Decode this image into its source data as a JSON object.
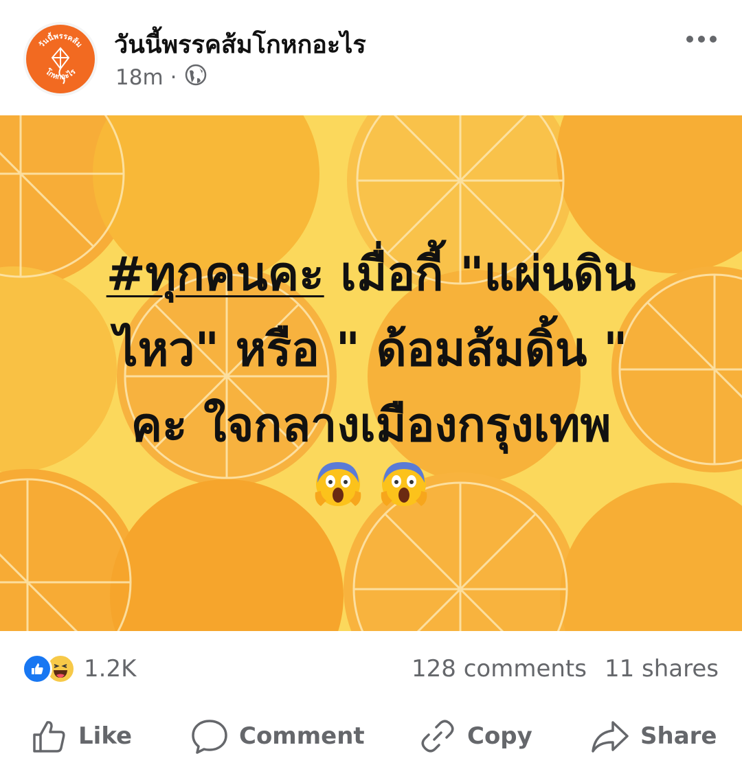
{
  "header": {
    "page_name": "วันนี้พรรคส้มโกหกอะไร",
    "time": "18m",
    "separator": "·",
    "privacy_icon": "globe-icon",
    "more_icon": "more-horizontal-icon",
    "avatar_text_top": "วันนี้พรรคส้ม",
    "avatar_text_bottom": "โกหกอะไร",
    "avatar_color": "#f26a21"
  },
  "post": {
    "background_colors": [
      "#fbd85c",
      "#f7b23a",
      "#f5a623"
    ],
    "hashtag": "#ทุกคนคะ",
    "line1_rest": " เมื่อกี้ \"แผ่นดิน",
    "line2": "ไหว\" หรือ \" ด้อมส้มดิ้น \"",
    "line3": "คะ  ใจกลางเมืองกรุงเทพ",
    "emojis": [
      "face-screaming-in-fear-icon",
      "face-screaming-in-fear-icon"
    ]
  },
  "reactions": {
    "icons": [
      "like-icon",
      "haha-icon"
    ],
    "count": "1.2K",
    "comments": "128 comments",
    "shares": "11 shares"
  },
  "actions": {
    "like": "Like",
    "comment": "Comment",
    "copy": "Copy",
    "share": "Share"
  },
  "colors": {
    "text_primary": "#050505",
    "text_secondary": "#65676b",
    "like_blue": "#1877f2"
  }
}
